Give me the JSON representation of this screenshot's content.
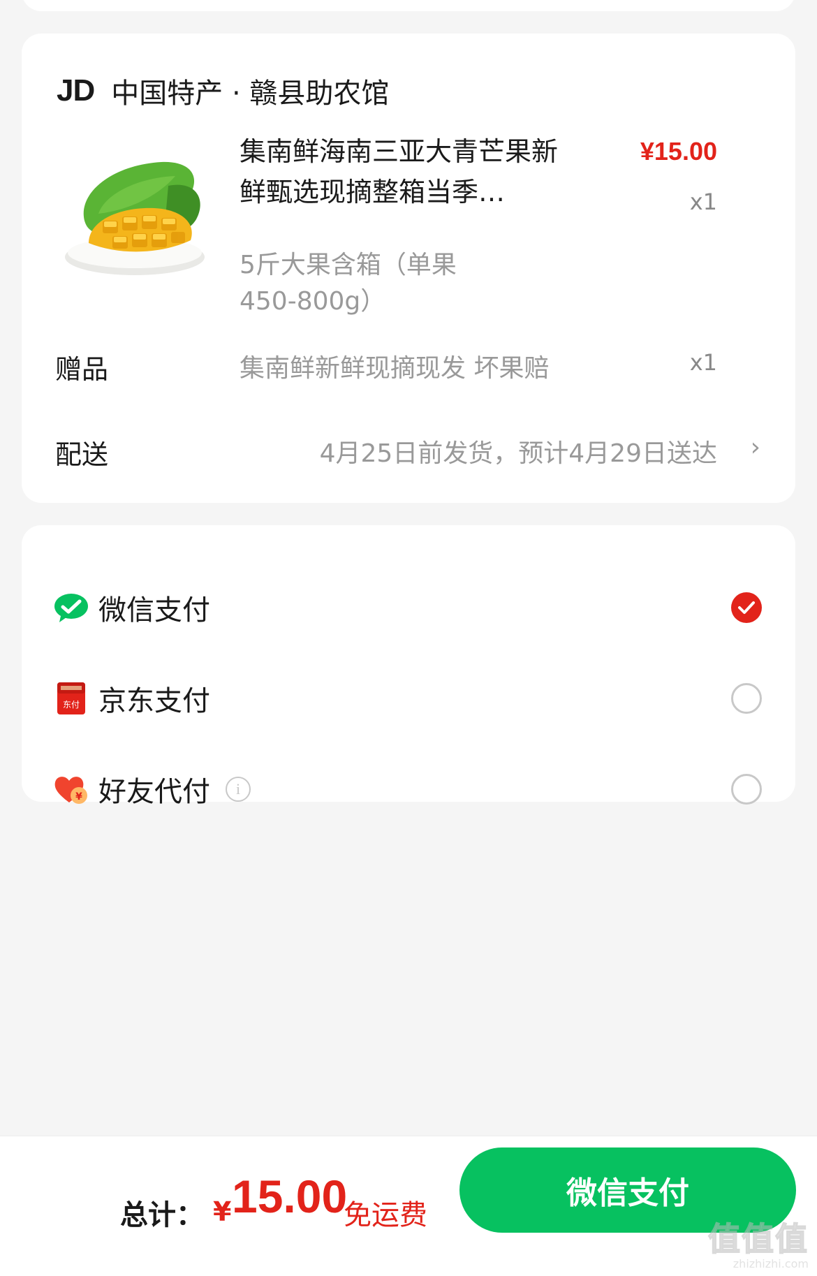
{
  "shop": {
    "logo": "JD",
    "name": "中国特产 · 赣县助农馆"
  },
  "product": {
    "title": "集南鲜海南三亚大青芒果新鲜甄选现摘整箱当季…",
    "price": "¥15.00",
    "qty": "x1",
    "spec": "5斤大果含箱（单果450-800g）",
    "image": "mango-image"
  },
  "gift": {
    "label": "赠品",
    "value": "集南鲜新鲜现摘现发 坏果赔",
    "qty": "x1"
  },
  "shipping": {
    "label": "配送",
    "value": "4月25日前发货，预计4月29日送达"
  },
  "payment_methods": [
    {
      "label": "微信支付",
      "icon": "wechat-pay-icon",
      "selected": true
    },
    {
      "label": "京东支付",
      "icon": "jd-pay-icon",
      "selected": false
    },
    {
      "label": "好友代付",
      "icon": "friend-pay-icon",
      "selected": false,
      "info": "i"
    }
  ],
  "footer": {
    "total_label": "总计：",
    "currency": "¥",
    "total_amount": "15.00",
    "shipping_note": "免运费",
    "pay_button": "微信支付"
  },
  "watermark": {
    "mark": "值值值",
    "url": "zhizhizhi.com"
  },
  "colors": {
    "accent_red": "#e2231a",
    "wechat_green": "#07c160"
  }
}
